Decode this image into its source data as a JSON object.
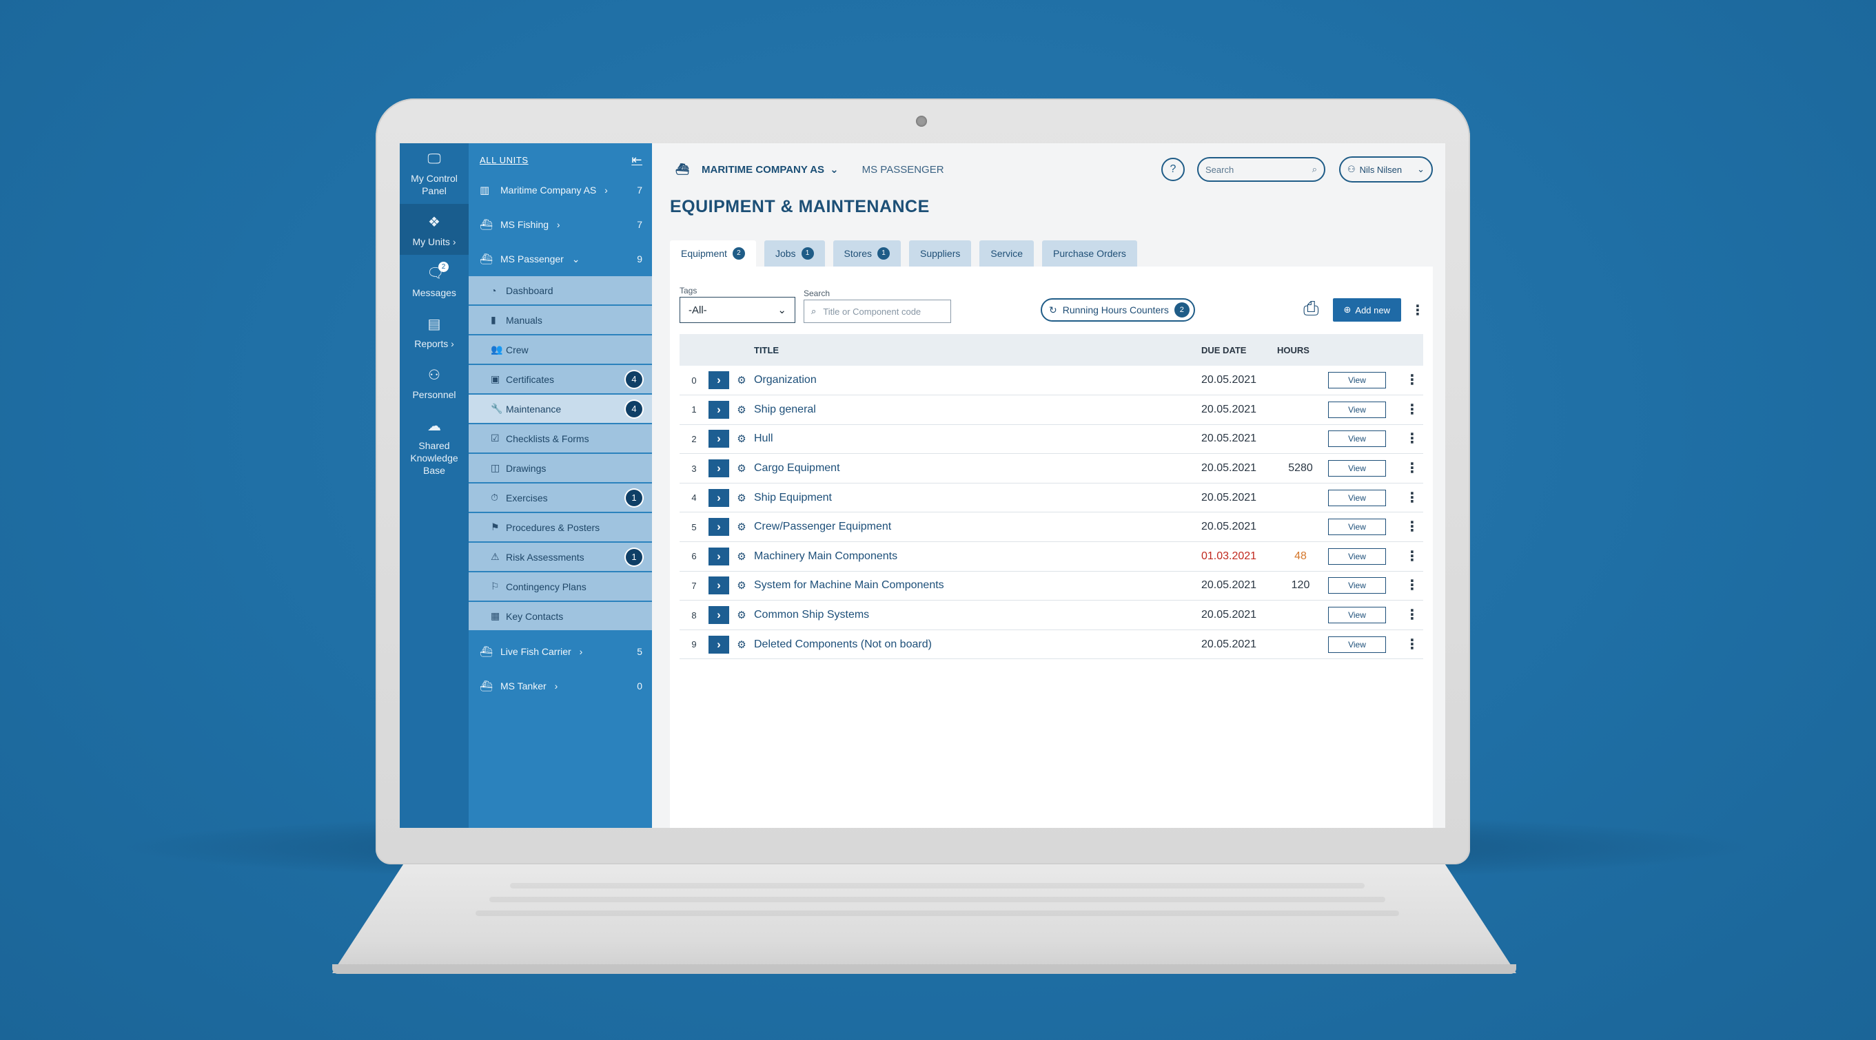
{
  "rail": [
    {
      "label": "My Control Panel",
      "icon": "monitor-icon"
    },
    {
      "label": "My Units",
      "icon": "diamond-grid-icon",
      "chevron": "›"
    },
    {
      "label": "Messages",
      "icon": "chat-icon",
      "badge": "2"
    },
    {
      "label": "Reports",
      "icon": "chart-icon",
      "chevron": "›"
    },
    {
      "label": "Personnel",
      "icon": "people-icon"
    },
    {
      "label": "Shared Knowledge Base",
      "icon": "cloud-upload-icon"
    }
  ],
  "sidebar": {
    "header": "ALL UNITS",
    "units_top": [
      {
        "label": "Maritime Company AS",
        "count": "7",
        "chevron": "›"
      },
      {
        "label": "MS Fishing",
        "count": "7",
        "chevron": "›"
      },
      {
        "label": "MS Passenger",
        "count": "9",
        "chevron": "⌄"
      }
    ],
    "sub_items": [
      {
        "label": "Dashboard",
        "icon": "dashboard-icon",
        "badge": ""
      },
      {
        "label": "Manuals",
        "icon": "book-icon",
        "badge": ""
      },
      {
        "label": "Crew",
        "icon": "crew-icon",
        "badge": ""
      },
      {
        "label": "Certificates",
        "icon": "certificate-icon",
        "badge": "4"
      },
      {
        "label": "Maintenance",
        "icon": "wrench-icon",
        "badge": "4"
      },
      {
        "label": "Checklists & Forms",
        "icon": "checklist-icon",
        "badge": ""
      },
      {
        "label": "Drawings",
        "icon": "drawings-icon",
        "badge": ""
      },
      {
        "label": "Exercises",
        "icon": "stopwatch-icon",
        "badge": "1"
      },
      {
        "label": "Procedures & Posters",
        "icon": "signpost-icon",
        "badge": ""
      },
      {
        "label": "Risk Assessments",
        "icon": "hazard-icon",
        "badge": "1"
      },
      {
        "label": "Contingency Plans",
        "icon": "plan-icon",
        "badge": ""
      },
      {
        "label": "Key Contacts",
        "icon": "contact-card-icon",
        "badge": ""
      }
    ],
    "units_bottom": [
      {
        "label": "Live Fish Carrier",
        "count": "5",
        "chevron": "›"
      },
      {
        "label": "MS Tanker",
        "count": "0",
        "chevron": "›"
      }
    ]
  },
  "topbar": {
    "company": "MARITIME COMPANY AS",
    "vessel": "MS PASSENGER",
    "help": "?",
    "search_placeholder": "Search",
    "user": "Nils Nilsen"
  },
  "page_title": "EQUIPMENT & MAINTENANCE",
  "tabs": [
    {
      "label": "Equipment",
      "badge": "2"
    },
    {
      "label": "Jobs",
      "badge": "1"
    },
    {
      "label": "Stores",
      "badge": "1"
    },
    {
      "label": "Suppliers",
      "badge": ""
    },
    {
      "label": "Service",
      "badge": ""
    },
    {
      "label": "Purchase Orders",
      "badge": ""
    }
  ],
  "filters": {
    "tags_label": "Tags",
    "tags_value": "-All-",
    "search_label": "Search",
    "search_placeholder": "Title or Component code",
    "running_hours": "Running Hours Counters",
    "running_hours_badge": "2",
    "add_new": "Add new"
  },
  "table": {
    "headers": {
      "title": "TITLE",
      "due": "DUE DATE",
      "hours": "HOURS"
    },
    "view_label": "View",
    "rows": [
      {
        "num": "0",
        "title": "Organization",
        "due": "20.05.2021",
        "hours": "",
        "overdue": false
      },
      {
        "num": "1",
        "title": "Ship general",
        "due": "20.05.2021",
        "hours": "",
        "overdue": false
      },
      {
        "num": "2",
        "title": "Hull",
        "due": "20.05.2021",
        "hours": "",
        "overdue": false
      },
      {
        "num": "3",
        "title": "Cargo Equipment",
        "due": "20.05.2021",
        "hours": "5280",
        "overdue": false
      },
      {
        "num": "4",
        "title": "Ship Equipment",
        "due": "20.05.2021",
        "hours": "",
        "overdue": false
      },
      {
        "num": "5",
        "title": "Crew/Passenger Equipment",
        "due": "20.05.2021",
        "hours": "",
        "overdue": false
      },
      {
        "num": "6",
        "title": "Machinery Main Components",
        "due": "01.03.2021",
        "hours": "48",
        "overdue": true
      },
      {
        "num": "7",
        "title": "System for Machine Main Components",
        "due": "20.05.2021",
        "hours": "120",
        "overdue": false
      },
      {
        "num": "8",
        "title": "Common Ship Systems",
        "due": "20.05.2021",
        "hours": "",
        "overdue": false
      },
      {
        "num": "9",
        "title": "Deleted Components (Not on board)",
        "due": "20.05.2021",
        "hours": "",
        "overdue": false
      }
    ]
  },
  "colors": {
    "background": "#1f6fa5",
    "rail": "#1f6ea6",
    "sidebar": "#2b82bd",
    "submenu": "#9fc3df",
    "accent": "#1d5e92",
    "overdue": "#c0281e",
    "warning": "#d4762a"
  }
}
